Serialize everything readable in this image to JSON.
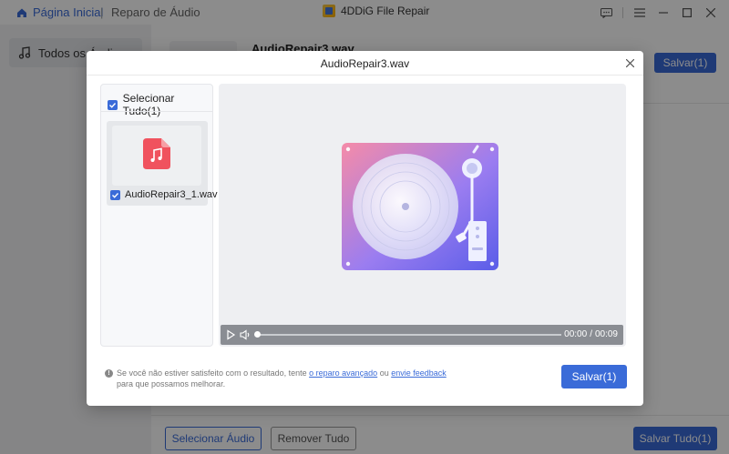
{
  "titlebar": {
    "home_label": "Página Inicial",
    "separator": "|",
    "current_label": "Reparo de Áudio",
    "app_name": "4DDiG File Repair"
  },
  "sidebar": {
    "items": [
      {
        "label": "Todos os Áudios"
      }
    ]
  },
  "main": {
    "file_name": "AudioRepair3.wav",
    "save_label": "Salvar(1)"
  },
  "bottombar": {
    "select_audio_label": "Selecionar Áudio",
    "remove_all_label": "Remover Tudo",
    "save_all_label": "Salvar Tudo(1)"
  },
  "modal": {
    "title": "AudioRepair3.wav",
    "select_all_label": "Selecionar Tudo(1)",
    "files": [
      {
        "name": "AudioRepair3_1.wav",
        "checked": true
      }
    ],
    "player": {
      "current_time": "00:00",
      "separator": "/",
      "total_time": "00:09",
      "progress": 0
    },
    "info": {
      "text_before": "Se você não estiver satisfeito com o resultado, tente ",
      "link1": "o reparo avançado",
      "text_mid": " ou ",
      "link2": "envie feedback",
      "text_after": "para que possamos melhorar."
    },
    "save_label": "Salvar(1)"
  },
  "colors": {
    "accent": "#3a6bd8",
    "music_icon": "#f0525e",
    "turntable_start": "#f58ba8",
    "turntable_end": "#5a5de8"
  }
}
